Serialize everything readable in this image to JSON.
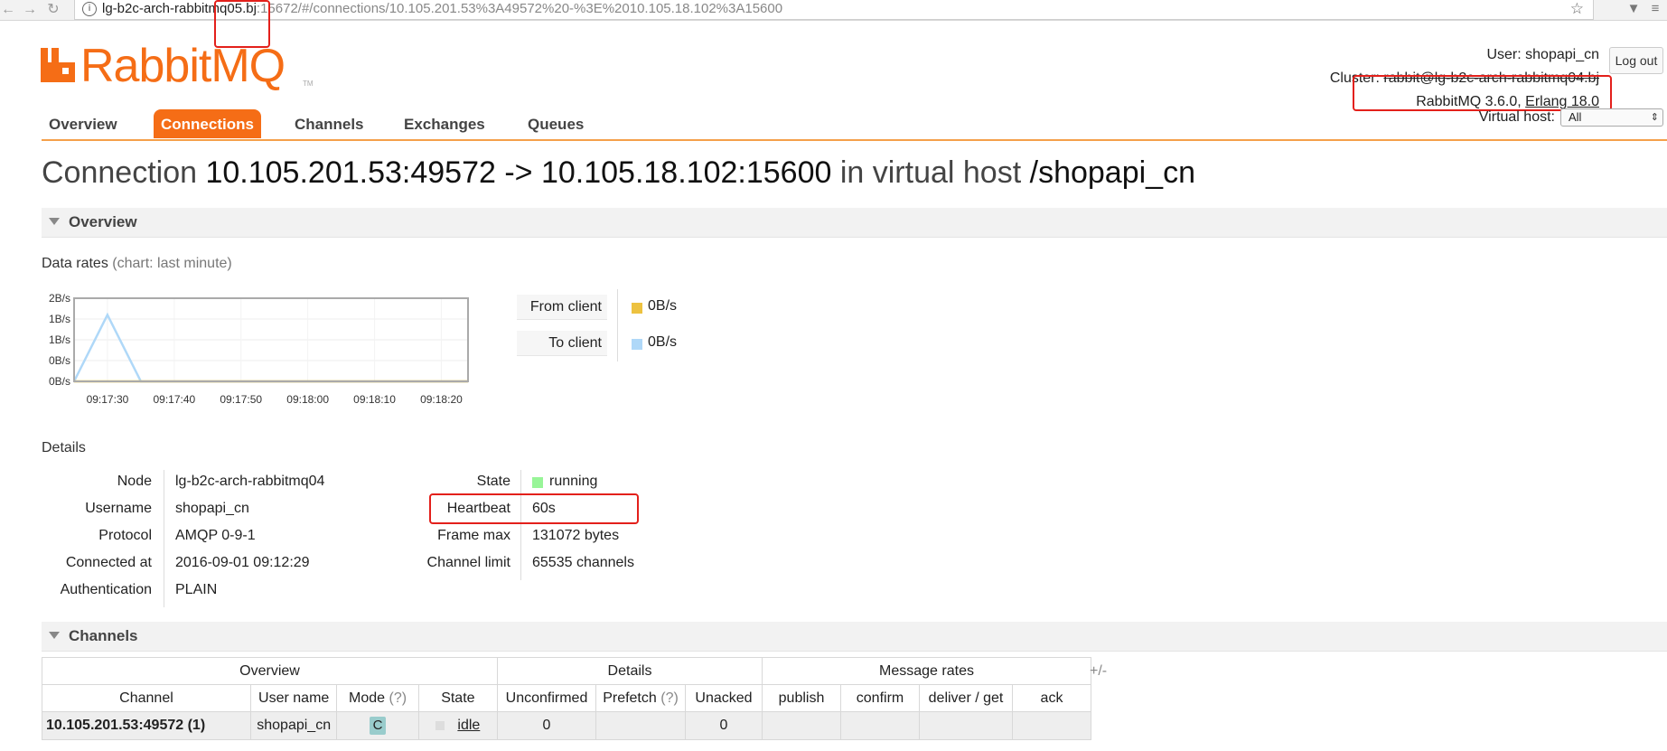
{
  "browser": {
    "url_host": "lg-b2c-arch-rabbitmq05.bj",
    "url_rest": ":15672/#/connections/10.105.201.53%3A49572%20-%3E%2010.105.18.102%3A15600"
  },
  "header": {
    "logo_text": "RabbitMQ",
    "logo_tm": "TM",
    "user_label": "User:",
    "user_name": "shopapi_cn",
    "cluster_label": "Cluster:",
    "cluster_name": "rabbit@lg-b2c-arch-rabbitmq04.bj",
    "version_text": "RabbitMQ 3.6.0,",
    "erlang_text": "Erlang 18.0",
    "logout_label": "Log out",
    "vhost_label": "Virtual host:",
    "vhost_value": "All"
  },
  "tabs": [
    {
      "label": "Overview"
    },
    {
      "label": "Connections"
    },
    {
      "label": "Channels"
    },
    {
      "label": "Exchanges"
    },
    {
      "label": "Queues"
    }
  ],
  "title": {
    "prefix": "Connection",
    "name": "10.105.201.53:49572 -> 10.105.18.102:15600",
    "mid": "in virtual host",
    "vhost": "/shopapi_cn"
  },
  "overview_section": {
    "label": "Overview"
  },
  "data_rates": {
    "heading": "Data rates",
    "paren": "(chart: last minute)",
    "legend": [
      {
        "label": "From client",
        "value": "0B/s",
        "color": "#edc240"
      },
      {
        "label": "To client",
        "value": "0B/s",
        "color": "#afd8f8"
      }
    ]
  },
  "chart_data": {
    "type": "line",
    "y_tick_labels": [
      "2B/s",
      "1B/s",
      "1B/s",
      "0B/s",
      "0B/s"
    ],
    "x_tick_labels": [
      "09:17:30",
      "09:17:40",
      "09:17:50",
      "09:18:00",
      "09:18:10",
      "09:18:20"
    ],
    "ylim": [
      0,
      2
    ],
    "series": [
      {
        "name": "To client",
        "color": "#afd8f8",
        "x": [
          "09:17:25",
          "09:17:30",
          "09:17:35",
          "09:17:40",
          "09:17:50",
          "09:18:00",
          "09:18:10",
          "09:18:20",
          "09:18:24"
        ],
        "values": [
          0,
          1.6,
          0,
          0,
          0,
          0,
          0,
          0,
          0
        ]
      },
      {
        "name": "From client",
        "color": "#edc240",
        "x": [
          "09:17:25",
          "09:18:24"
        ],
        "values": [
          0,
          0
        ]
      }
    ],
    "grid": true
  },
  "details": {
    "heading": "Details",
    "left": [
      {
        "key": "Node",
        "value": "lg-b2c-arch-rabbitmq04"
      },
      {
        "key": "Username",
        "value": "shopapi_cn"
      },
      {
        "key": "Protocol",
        "value": "AMQP 0-9-1"
      },
      {
        "key": "Connected at",
        "value": "2016-09-01 09:12:29"
      },
      {
        "key": "Authentication",
        "value": "PLAIN"
      }
    ],
    "right": [
      {
        "key": "State",
        "value": "running"
      },
      {
        "key": "Heartbeat",
        "value": "60s"
      },
      {
        "key": "Frame max",
        "value": "131072 bytes"
      },
      {
        "key": "Channel limit",
        "value": "65535 channels"
      }
    ],
    "state_color": "#98f598"
  },
  "channels_section": {
    "label": "Channels"
  },
  "channels_table": {
    "groups": [
      "Overview",
      "Details",
      "Message rates"
    ],
    "plus_minus": "+/-",
    "columns": {
      "channel": "Channel",
      "user_name": "User name",
      "mode": "Mode",
      "mode_help": "(?)",
      "state": "State",
      "unconfirmed": "Unconfirmed",
      "prefetch": "Prefetch",
      "prefetch_help": "(?)",
      "unacked": "Unacked",
      "publish": "publish",
      "confirm": "confirm",
      "deliver_get": "deliver / get",
      "ack": "ack"
    },
    "rows": [
      {
        "channel": "10.105.201.53:49572 (1)",
        "user_name": "shopapi_cn",
        "mode": "C",
        "state": "idle",
        "unconfirmed": "0",
        "prefetch": "",
        "unacked": "0",
        "publish": "",
        "confirm": "",
        "deliver_get": "",
        "ack": ""
      }
    ]
  }
}
